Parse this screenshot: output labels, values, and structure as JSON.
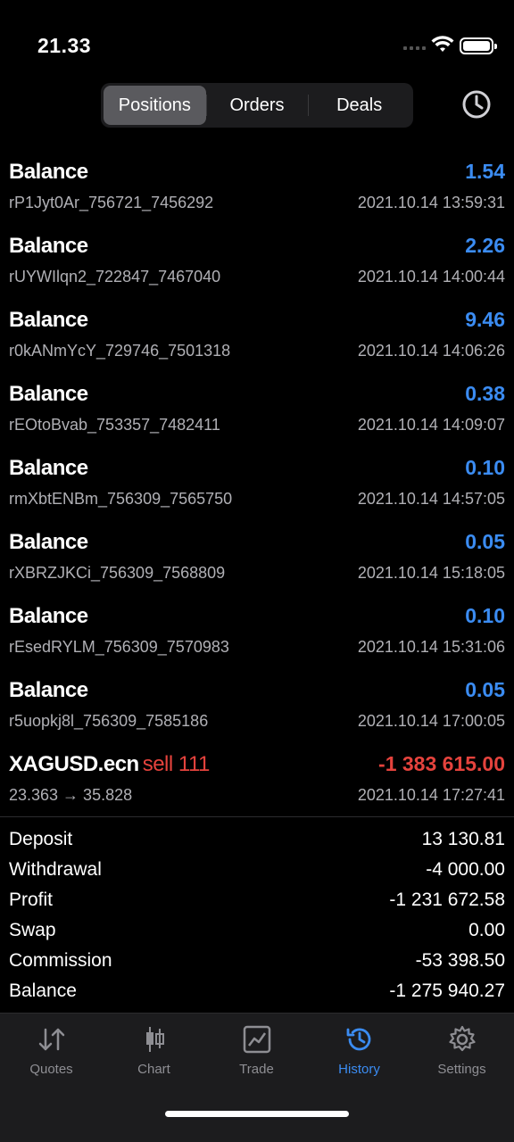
{
  "status": {
    "time": "21.33"
  },
  "tabs": {
    "positions": "Positions",
    "orders": "Orders",
    "deals": "Deals"
  },
  "deals": [
    {
      "title": "Balance",
      "op": "",
      "amount": "1.54",
      "sub": "rP1Jyt0Ar_756721_7456292",
      "date": "2021.10.14 13:59:31"
    },
    {
      "title": "Balance",
      "op": "",
      "amount": "2.26",
      "sub": "rUYWIlqn2_722847_7467040",
      "date": "2021.10.14 14:00:44"
    },
    {
      "title": "Balance",
      "op": "",
      "amount": "9.46",
      "sub": "r0kANmYcY_729746_7501318",
      "date": "2021.10.14 14:06:26"
    },
    {
      "title": "Balance",
      "op": "",
      "amount": "0.38",
      "sub": "rEOtoBvab_753357_7482411",
      "date": "2021.10.14 14:09:07"
    },
    {
      "title": "Balance",
      "op": "",
      "amount": "0.10",
      "sub": "rmXbtENBm_756309_7565750",
      "date": "2021.10.14 14:57:05"
    },
    {
      "title": "Balance",
      "op": "",
      "amount": "0.05",
      "sub": "rXBRZJKCi_756309_7568809",
      "date": "2021.10.14 15:18:05"
    },
    {
      "title": "Balance",
      "op": "",
      "amount": "0.10",
      "sub": "rEsedRYLM_756309_7570983",
      "date": "2021.10.14 15:31:06"
    },
    {
      "title": "Balance",
      "op": "",
      "amount": "0.05",
      "sub": "r5uopkj8l_756309_7585186",
      "date": "2021.10.14 17:00:05"
    },
    {
      "title": "XAGUSD.ecn",
      "op": "sell 111",
      "amount": "-1 383 615.00",
      "sub": "23.363 → 35.828",
      "date": "2021.10.14 17:27:41"
    }
  ],
  "summary": [
    {
      "label": "Deposit",
      "value": "13 130.81"
    },
    {
      "label": "Withdrawal",
      "value": "-4 000.00"
    },
    {
      "label": "Profit",
      "value": "-1 231 672.58"
    },
    {
      "label": "Swap",
      "value": "0.00"
    },
    {
      "label": "Commission",
      "value": "-53 398.50"
    },
    {
      "label": "Balance",
      "value": "-1 275 940.27"
    }
  ],
  "nav": {
    "quotes": "Quotes",
    "chart": "Chart",
    "trade": "Trade",
    "history": "History",
    "settings": "Settings"
  },
  "colors": {
    "positive": "#3b8cf2",
    "negative": "#e5433d",
    "active_tab": "#3b8cf2"
  }
}
